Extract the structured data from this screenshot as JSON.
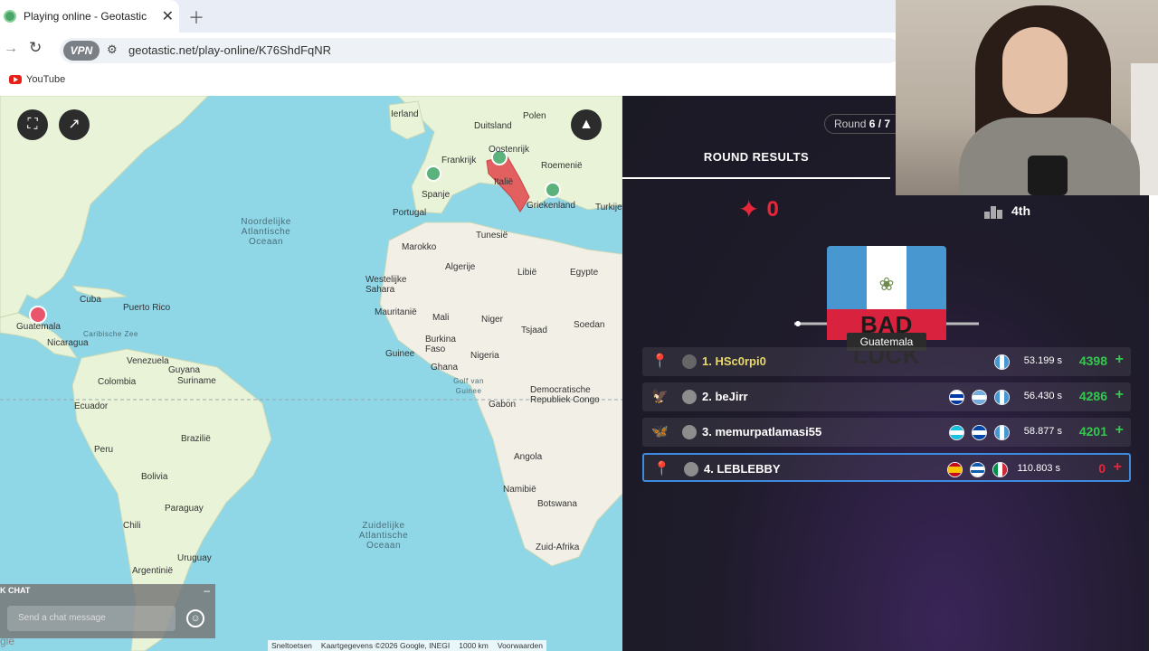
{
  "browser": {
    "tab_title": "Playing online - Geotastic",
    "url": "geotastic.net/play-online/K76ShdFqNR",
    "vpn_label": "VPN",
    "bookmark_youtube": "YouTube"
  },
  "map": {
    "labels": [
      {
        "text": "Ierland"
      },
      {
        "text": "Duitsland"
      },
      {
        "text": "Polen"
      },
      {
        "text": "Oostenrijk"
      },
      {
        "text": "Frankrijk"
      },
      {
        "text": "Roemenië"
      },
      {
        "text": "Italië"
      },
      {
        "text": "Spanje"
      },
      {
        "text": "Portugal"
      },
      {
        "text": "Griekenland"
      },
      {
        "text": "Turkije"
      },
      {
        "text": "Tunesië"
      },
      {
        "text": "Marokko"
      },
      {
        "text": "Algerije"
      },
      {
        "text": "Libië"
      },
      {
        "text": "Egypte"
      },
      {
        "text": "Westelijke Sahara"
      },
      {
        "text": "Mauritanië"
      },
      {
        "text": "Mali"
      },
      {
        "text": "Niger"
      },
      {
        "text": "Tsjaad"
      },
      {
        "text": "Soedan"
      },
      {
        "text": "Guinee"
      },
      {
        "text": "Burkina Faso"
      },
      {
        "text": "Ghana"
      },
      {
        "text": "Nigeria"
      },
      {
        "text": "Golf van Guinee"
      },
      {
        "text": "Gabon"
      },
      {
        "text": "Democratische Republiek Congo"
      },
      {
        "text": "Angola"
      },
      {
        "text": "Namibië"
      },
      {
        "text": "Botswana"
      },
      {
        "text": "Zuid-Afrika"
      },
      {
        "text": "Cuba"
      },
      {
        "text": "Puerto Rico"
      },
      {
        "text": "Guatemala"
      },
      {
        "text": "Caribische Zee"
      },
      {
        "text": "Nicaragua"
      },
      {
        "text": "Venezuela"
      },
      {
        "text": "Guyana"
      },
      {
        "text": "Suriname"
      },
      {
        "text": "Colombia"
      },
      {
        "text": "Ecuador"
      },
      {
        "text": "Peru"
      },
      {
        "text": "Brazilië"
      },
      {
        "text": "Bolivia"
      },
      {
        "text": "Paraguay"
      },
      {
        "text": "Chili"
      },
      {
        "text": "Uruguay"
      },
      {
        "text": "Argentinië"
      }
    ],
    "oceans": [
      "Noordelijke Atlantische Oceaan",
      "Zuidelijke Atlantische Oceaan"
    ],
    "attribution": [
      "Sneltoetsen",
      "Kaartgegevens ©2026 Google, INEGI",
      "1000 km",
      "Voorwaarden"
    ],
    "google_text": "gle"
  },
  "chat": {
    "header": "K CHAT",
    "placeholder": "Send a chat message"
  },
  "results": {
    "round_label": "Round ",
    "round_value": "6 / 7",
    "tab_title": "ROUND RESULTS",
    "my_score": "0",
    "my_rank": "4th",
    "country": "Guatemala",
    "banner": "BAD LUCK",
    "rows": [
      {
        "name": "1. HSc0rpi0",
        "time": "53.199 s",
        "points": "4398",
        "flags": [
          "guatemala"
        ],
        "pin": "📍"
      },
      {
        "name": "2. beJirr",
        "time": "56.430 s",
        "points": "4286",
        "flags": [
          "uruguay",
          "argentina",
          "guatemala"
        ],
        "pin": "🦅"
      },
      {
        "name": "3. memurpatlamasi55",
        "time": "58.877 s",
        "points": "4201",
        "flags": [
          "honduras",
          "el-salvador",
          "guatemala"
        ],
        "pin": "🦋"
      },
      {
        "name": "4. LEBLEBBY",
        "time": "110.803 s",
        "points": "0",
        "flags": [
          "spain",
          "greece",
          "italy"
        ],
        "pin": "📍"
      }
    ],
    "plus_symbol": "+"
  },
  "colors": {
    "accent_red": "#e8263a",
    "accent_green": "#34c84f",
    "highlight_blue": "#3d8be0",
    "map_water": "#8fd6e6",
    "map_land": "#e8f3d8"
  }
}
